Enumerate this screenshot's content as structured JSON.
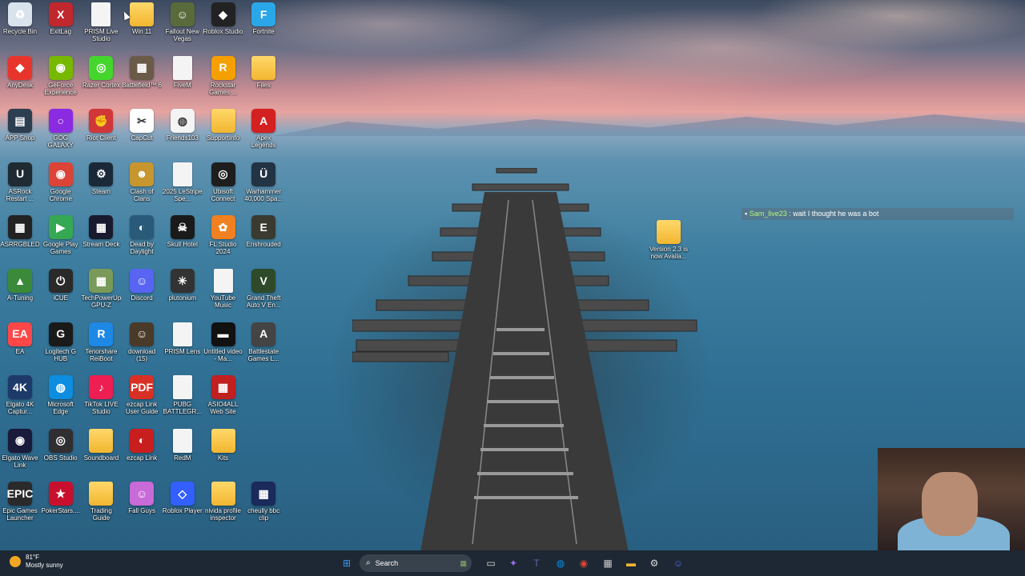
{
  "desktop": {
    "icons": [
      {
        "label": "Recycle Bin",
        "glyph": "♻",
        "color": "#d9e3ee",
        "kind": "app"
      },
      {
        "label": "ExitLag",
        "glyph": "X",
        "color": "#c0282d",
        "kind": "app"
      },
      {
        "label": "PRISM Live Studio",
        "glyph": "",
        "color": "#f4f4f4",
        "kind": "file"
      },
      {
        "label": "Win 11",
        "glyph": "",
        "color": "#f2b630",
        "kind": "folder"
      },
      {
        "label": "Fallout New Vegas",
        "glyph": "☺",
        "color": "#5a6b3b",
        "kind": "app"
      },
      {
        "label": "Roblox Studio",
        "glyph": "◆",
        "color": "#222222",
        "kind": "app"
      },
      {
        "label": "Fortnite",
        "glyph": "F",
        "color": "#2aa7e8",
        "kind": "app"
      },
      {
        "label": "AnyDesk",
        "glyph": "◆",
        "color": "#e8352b",
        "kind": "app"
      },
      {
        "label": "GeForce Experience",
        "glyph": "◉",
        "color": "#76b900",
        "kind": "app"
      },
      {
        "label": "Razer Cortex",
        "glyph": "◎",
        "color": "#44d62c",
        "kind": "app"
      },
      {
        "label": "Battlefield™ 6",
        "glyph": "▦",
        "color": "#6a5a48",
        "kind": "app"
      },
      {
        "label": "FiveM",
        "glyph": "",
        "color": "#f4f4f4",
        "kind": "file"
      },
      {
        "label": "Rockstar Games ...",
        "glyph": "R",
        "color": "#f5a000",
        "kind": "app"
      },
      {
        "label": "Files",
        "glyph": "",
        "color": "#f2b630",
        "kind": "folder"
      },
      {
        "label": "APP Shop",
        "glyph": "▤",
        "color": "#2c3e50",
        "kind": "app"
      },
      {
        "label": "GOG GALAXY",
        "glyph": "○",
        "color": "#8a2be2",
        "kind": "app"
      },
      {
        "label": "Riot Client",
        "glyph": "✊",
        "color": "#d13639",
        "kind": "app"
      },
      {
        "label": "CapCut",
        "glyph": "✂",
        "color": "#ffffff",
        "kind": "app"
      },
      {
        "label": "Friends103",
        "glyph": "◍",
        "color": "#f4f4f4",
        "kind": "app"
      },
      {
        "label": "SupportInfo",
        "glyph": "",
        "color": "#f2b630",
        "kind": "folder"
      },
      {
        "label": "Apex Legends",
        "glyph": "A",
        "color": "#d32020",
        "kind": "app"
      },
      {
        "label": "ASRock Restart ...",
        "glyph": "U",
        "color": "#1f2a33",
        "kind": "app"
      },
      {
        "label": "Google Chrome",
        "glyph": "◉",
        "color": "#db4437",
        "kind": "app"
      },
      {
        "label": "Steam",
        "glyph": "⚙",
        "color": "#1b2838",
        "kind": "app"
      },
      {
        "label": "Clash of Clans",
        "glyph": "☻",
        "color": "#c8962e",
        "kind": "app"
      },
      {
        "label": "2025 LeStripe Spe...",
        "glyph": "",
        "color": "#f4f4f4",
        "kind": "file"
      },
      {
        "label": "Ubisoft Connect",
        "glyph": "◎",
        "color": "#1e1e1e",
        "kind": "app"
      },
      {
        "label": "Warhammer 40,000 Spa...",
        "glyph": "Ü",
        "color": "#223344",
        "kind": "app"
      },
      {
        "label": "ASRRGBLED",
        "glyph": "▦",
        "color": "#222222",
        "kind": "app"
      },
      {
        "label": "Google Play Games",
        "glyph": "▶",
        "color": "#34a853",
        "kind": "app"
      },
      {
        "label": "Stream Deck",
        "glyph": "▦",
        "color": "#1a1a2e",
        "kind": "app"
      },
      {
        "label": "Dead by Daylight",
        "glyph": "◐",
        "color": "#2a5a7a",
        "kind": "app"
      },
      {
        "label": "Skull Hotel",
        "glyph": "☠",
        "color": "#1a1a1a",
        "kind": "app"
      },
      {
        "label": "FL Studio 2024",
        "glyph": "✿",
        "color": "#f08020",
        "kind": "app"
      },
      {
        "label": "Enshrouded",
        "glyph": "E",
        "color": "#3a3a30",
        "kind": "app"
      },
      {
        "label": "A-Tuning",
        "glyph": "▲",
        "color": "#3a8a3a",
        "kind": "app"
      },
      {
        "label": "iCUE",
        "glyph": "⏻",
        "color": "#2a2a2a",
        "kind": "app"
      },
      {
        "label": "TechPowerUp GPU-Z",
        "glyph": "▦",
        "color": "#7a9a5a",
        "kind": "app"
      },
      {
        "label": "Discord",
        "glyph": "☺",
        "color": "#5865f2",
        "kind": "app"
      },
      {
        "label": "plutonium",
        "glyph": "✳",
        "color": "#333333",
        "kind": "app"
      },
      {
        "label": "YouTube Music",
        "glyph": "",
        "color": "#f4f4f4",
        "kind": "file"
      },
      {
        "label": "Grand Theft Auto V En...",
        "glyph": "V",
        "color": "#2e4a2a",
        "kind": "app"
      },
      {
        "label": "EA",
        "glyph": "EA",
        "color": "#ff4747",
        "kind": "app"
      },
      {
        "label": "Logitech G HUB",
        "glyph": "G",
        "color": "#1a1a1a",
        "kind": "app"
      },
      {
        "label": "Tenorshare ReiBoot",
        "glyph": "R",
        "color": "#1e88e5",
        "kind": "app"
      },
      {
        "label": "download (15)",
        "glyph": "☺",
        "color": "#4a3a2a",
        "kind": "app"
      },
      {
        "label": "PRISM Lens",
        "glyph": "",
        "color": "#f4f4f4",
        "kind": "file"
      },
      {
        "label": "Untitled video - Ma...",
        "glyph": "▬",
        "color": "#111111",
        "kind": "app"
      },
      {
        "label": "Battlestate Games L...",
        "glyph": "A",
        "color": "#444444",
        "kind": "app"
      },
      {
        "label": "Elgato 4K Captur...",
        "glyph": "4K",
        "color": "#1e3a6a",
        "kind": "app"
      },
      {
        "label": "Microsoft Edge",
        "glyph": "◍",
        "color": "#0c8de0",
        "kind": "app"
      },
      {
        "label": "TikTok LIVE Studio",
        "glyph": "♪",
        "color": "#ee1d52",
        "kind": "app"
      },
      {
        "label": "ezcap Link User Guide",
        "glyph": "PDF",
        "color": "#d93025",
        "kind": "app"
      },
      {
        "label": "PUBG BATTLEGR...",
        "glyph": "",
        "color": "#f4f4f4",
        "kind": "file"
      },
      {
        "label": "ASIO4ALL Web Site",
        "glyph": "▦",
        "color": "#c02020",
        "kind": "app"
      },
      {
        "label": "",
        "glyph": "",
        "color": "",
        "kind": "empty"
      },
      {
        "label": "Elgato Wave Link",
        "glyph": "◉",
        "color": "#1a1a3a",
        "kind": "app"
      },
      {
        "label": "OBS Studio",
        "glyph": "◎",
        "color": "#302e31",
        "kind": "app"
      },
      {
        "label": "Soundboard",
        "glyph": "",
        "color": "#f2b630",
        "kind": "folder"
      },
      {
        "label": "ezcap Link",
        "glyph": "◐",
        "color": "#c81e1e",
        "kind": "app"
      },
      {
        "label": "RedM",
        "glyph": "",
        "color": "#f4f4f4",
        "kind": "file"
      },
      {
        "label": "Kits",
        "glyph": "",
        "color": "#f2b630",
        "kind": "folder"
      },
      {
        "label": "",
        "glyph": "",
        "color": "",
        "kind": "empty"
      },
      {
        "label": "Epic Games Launcher",
        "glyph": "EPIC",
        "color": "#2a2a2a",
        "kind": "app"
      },
      {
        "label": "PokerStars....",
        "glyph": "★",
        "color": "#c8102e",
        "kind": "app"
      },
      {
        "label": "Trading Guide",
        "glyph": "",
        "color": "#f2b630",
        "kind": "folder"
      },
      {
        "label": "Fall Guys",
        "glyph": "☺",
        "color": "#c86ad8",
        "kind": "app"
      },
      {
        "label": "Roblox Player",
        "glyph": "◇",
        "color": "#335fff",
        "kind": "app"
      },
      {
        "label": "nivida profile inspector",
        "glyph": "",
        "color": "#f2b630",
        "kind": "folder"
      },
      {
        "label": "cheully bbc clip",
        "glyph": "▦",
        "color": "#1a2a5a",
        "kind": "app"
      }
    ],
    "extra_folder": {
      "label": "Version 2.3 is now Availa..."
    }
  },
  "chat_overlay": {
    "user": "Sam_live23",
    "message": ": wait I thought he was a bot"
  },
  "taskbar": {
    "weather_temp": "81°F",
    "weather_desc": "Mostly sunny",
    "search_label": "Search",
    "pinned": [
      {
        "name": "start-button",
        "glyph": "⊞",
        "color": "#3a9bf0"
      },
      {
        "name": "task-view-button",
        "glyph": "▭",
        "color": "#dddddd"
      },
      {
        "name": "copilot-app",
        "glyph": "✦",
        "color": "#9b6bf0"
      },
      {
        "name": "teams-app",
        "glyph": "T",
        "color": "#6264a7"
      },
      {
        "name": "edge-app",
        "glyph": "◍",
        "color": "#0c8de0"
      },
      {
        "name": "chrome-app",
        "glyph": "◉",
        "color": "#db4437"
      },
      {
        "name": "store-app",
        "glyph": "▦",
        "color": "#cccccc"
      },
      {
        "name": "file-explorer-app",
        "glyph": "▬",
        "color": "#f2b630"
      },
      {
        "name": "recorder-app",
        "glyph": "⚙",
        "color": "#dddddd"
      },
      {
        "name": "discord-app",
        "glyph": "☺",
        "color": "#5865f2"
      }
    ]
  }
}
